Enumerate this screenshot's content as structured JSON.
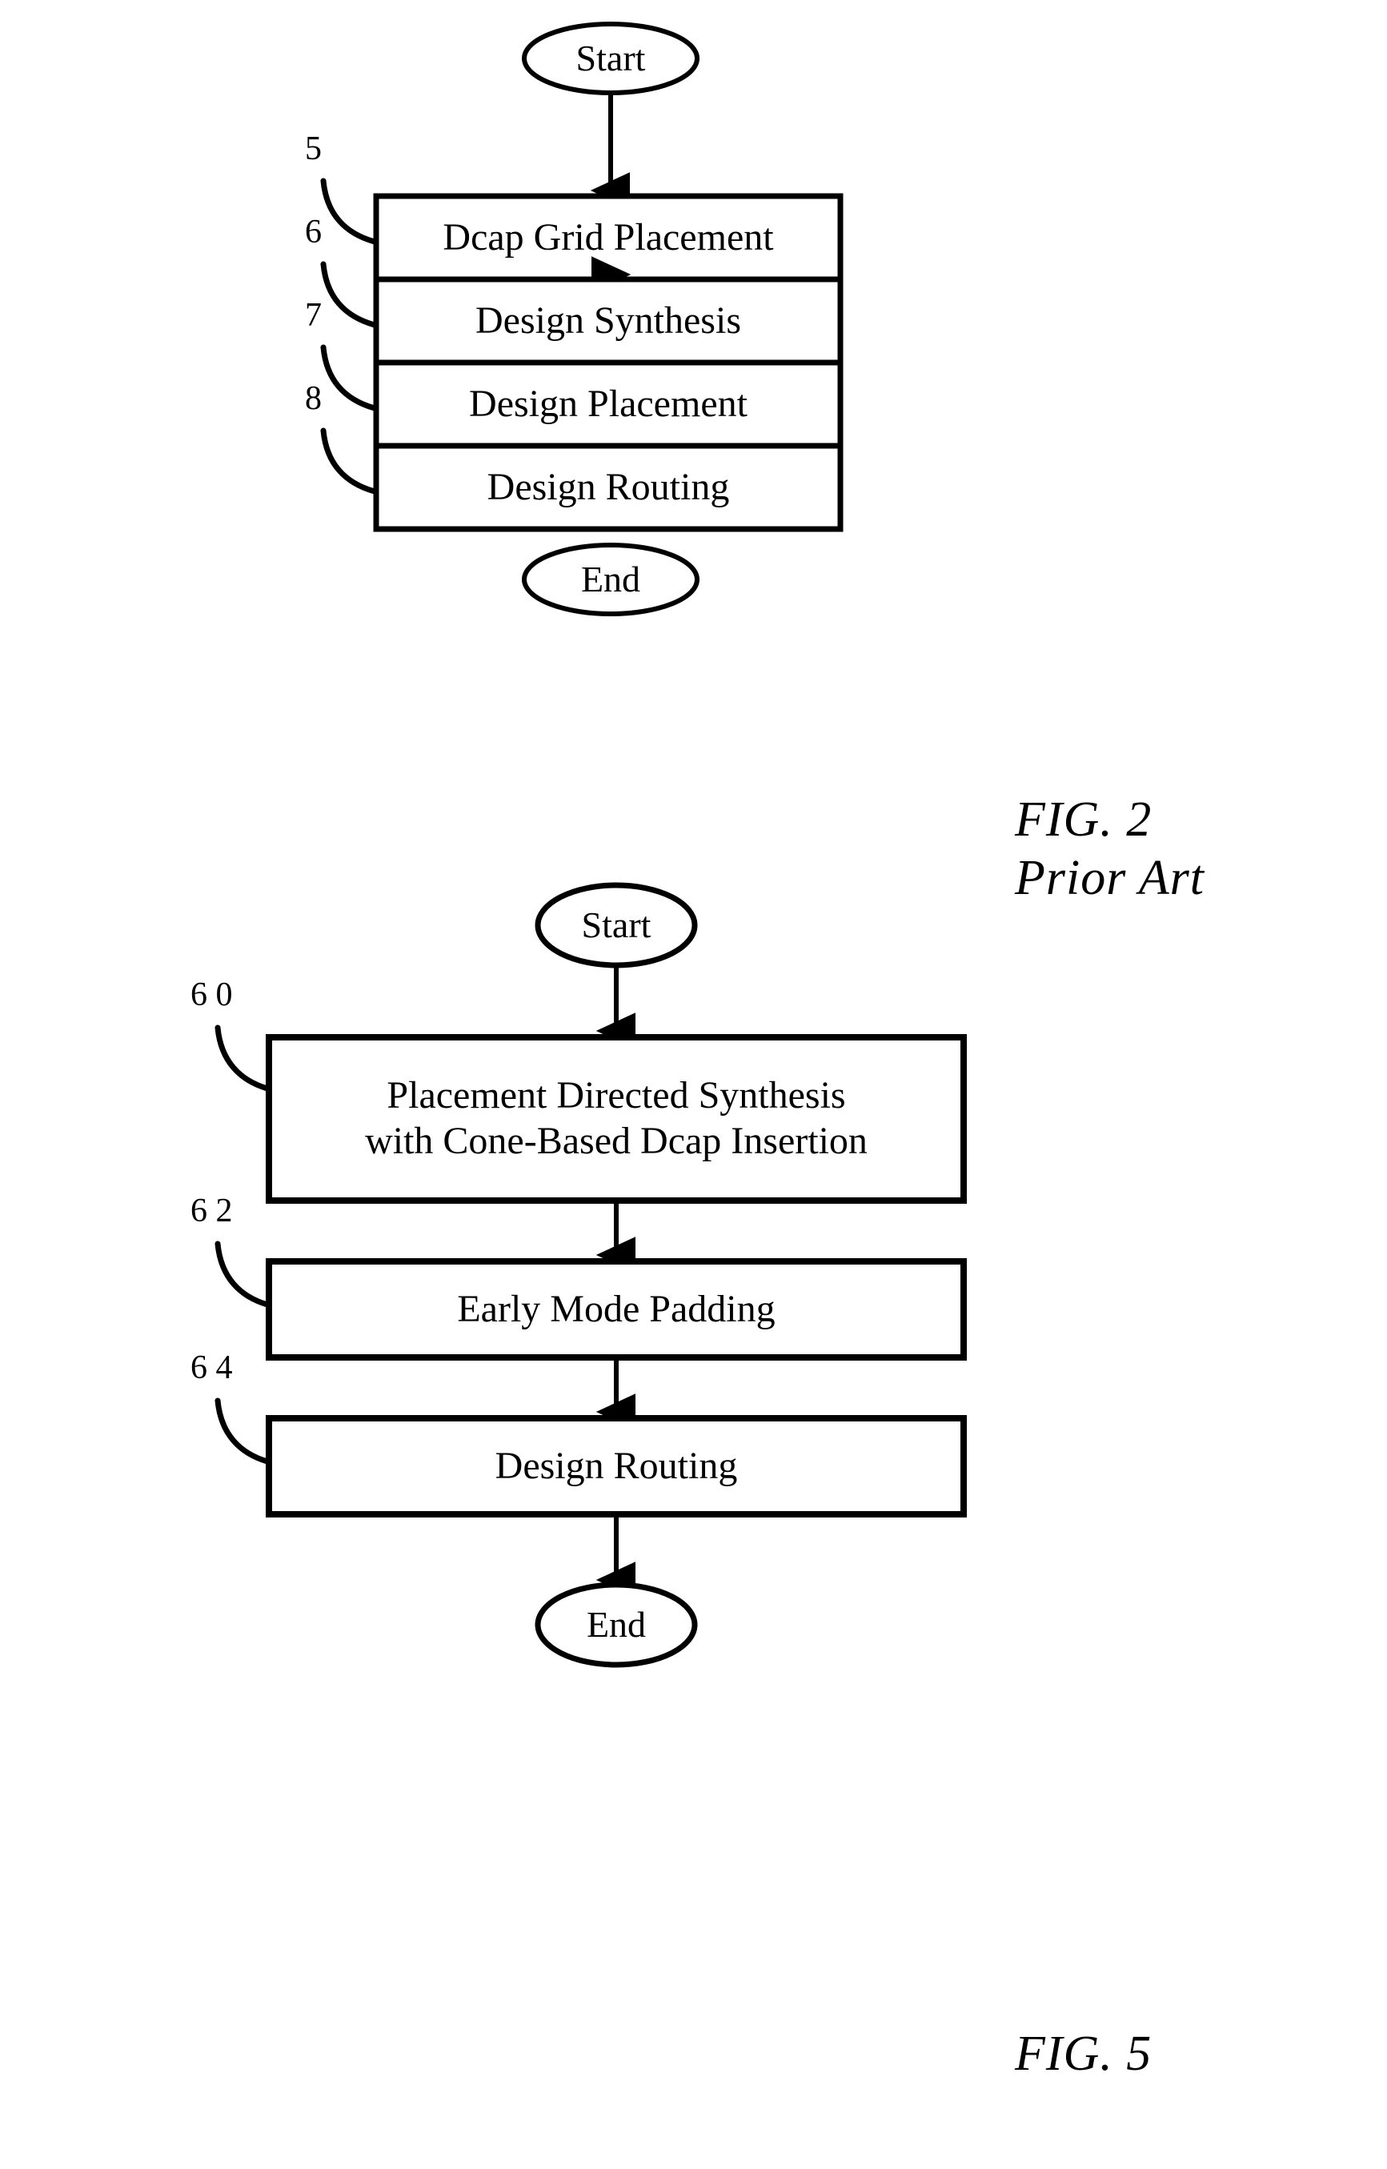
{
  "document": {
    "type": "patent-drawing-sheet",
    "background_color": "#ffffff",
    "line_color": "#000000"
  },
  "figures": [
    {
      "id": "fig-2",
      "caption_lines": [
        "FIG. 2",
        "Prior Art"
      ],
      "caption_line_1": "FIG. 2",
      "caption_line_2": "Prior Art",
      "chart_data": {
        "type": "flowchart",
        "orientation": "top-to-bottom",
        "nodes": [
          {
            "id": "start",
            "shape": "ellipse",
            "label": "Start",
            "ref": ""
          },
          {
            "id": "n5",
            "shape": "rectangle",
            "label": "Dcap Grid Placement",
            "ref": "5"
          },
          {
            "id": "n6",
            "shape": "rectangle",
            "label": "Design Synthesis",
            "ref": "6"
          },
          {
            "id": "n7",
            "shape": "rectangle",
            "label": "Design Placement",
            "ref": "7"
          },
          {
            "id": "n8",
            "shape": "rectangle",
            "label": "Design Routing",
            "ref": "8"
          },
          {
            "id": "end",
            "shape": "ellipse",
            "label": "End",
            "ref": ""
          }
        ],
        "edges": [
          {
            "from": "start",
            "to": "n5",
            "arrow": "down"
          },
          {
            "from": "n5",
            "to": "n6",
            "arrow": "down"
          },
          {
            "from": "n6",
            "to": "n7",
            "arrow": "down"
          },
          {
            "from": "n7",
            "to": "n8",
            "arrow": "down"
          },
          {
            "from": "n8",
            "to": "end",
            "arrow": "down"
          }
        ]
      }
    },
    {
      "id": "fig-5",
      "caption_lines": [
        "FIG. 5"
      ],
      "caption_line_1": "FIG. 5",
      "chart_data": {
        "type": "flowchart",
        "orientation": "top-to-bottom",
        "nodes": [
          {
            "id": "start",
            "shape": "ellipse",
            "label": "Start",
            "ref": ""
          },
          {
            "id": "n60",
            "shape": "rectangle",
            "label": "Placement Directed Synthesis with Cone-Based Dcap Insertion",
            "label_line_1": "Placement Directed Synthesis",
            "label_line_2": "with Cone-Based Dcap Insertion",
            "ref": "6 0"
          },
          {
            "id": "n62",
            "shape": "rectangle",
            "label": "Early Mode Padding",
            "ref": "6 2"
          },
          {
            "id": "n64",
            "shape": "rectangle",
            "label": "Design Routing",
            "ref": "6 4"
          },
          {
            "id": "end",
            "shape": "ellipse",
            "label": "End",
            "ref": ""
          }
        ],
        "edges": [
          {
            "from": "start",
            "to": "n60",
            "arrow": "down"
          },
          {
            "from": "n60",
            "to": "n62",
            "arrow": "down"
          },
          {
            "from": "n62",
            "to": "n64",
            "arrow": "down"
          },
          {
            "from": "n64",
            "to": "end",
            "arrow": "down"
          }
        ]
      }
    }
  ],
  "fig2": {
    "start_label": "Start",
    "end_label": "End",
    "boxes": [
      {
        "ref": "5",
        "label": "Dcap Grid Placement"
      },
      {
        "ref": "6",
        "label": "Design Synthesis"
      },
      {
        "ref": "7",
        "label": "Design Placement"
      },
      {
        "ref": "8",
        "label": "Design Routing"
      }
    ],
    "caption_1": "FIG. 2",
    "caption_2": "Prior Art"
  },
  "fig5": {
    "start_label": "Start",
    "end_label": "End",
    "boxes": [
      {
        "ref": "6 0",
        "label_1": "Placement Directed Synthesis",
        "label_2": "with Cone-Based Dcap Insertion"
      },
      {
        "ref": "6 2",
        "label_1": "Early Mode Padding",
        "label_2": ""
      },
      {
        "ref": "6 4",
        "label_1": "Design Routing",
        "label_2": ""
      }
    ],
    "caption_1": "FIG. 5"
  }
}
